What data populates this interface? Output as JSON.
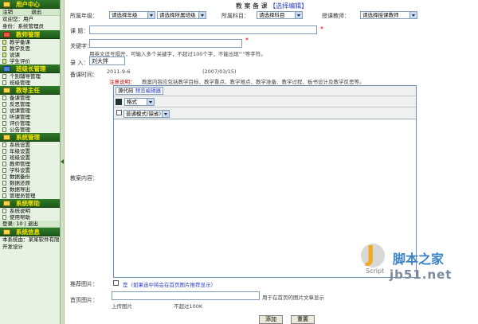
{
  "sidebar": {
    "user_center": "用户中心",
    "user_links": [
      "注销",
      "退出"
    ],
    "user_info": "欢迎您：用户",
    "user_role": "身份：系统管理员",
    "sections": [
      {
        "title": "教师管理",
        "items": [
          "教学备课",
          "教学反思",
          "说课",
          "学生评价"
        ]
      },
      {
        "title": "班级长管理",
        "items": [
          "个别辅导管理",
          "班级管理"
        ]
      },
      {
        "title": "教导主任",
        "items": [
          "备课管理",
          "反思管理",
          "说课管理",
          "听课管理",
          "评价管理",
          "公告管理"
        ]
      },
      {
        "title": "系统管理",
        "items": [
          "系统设置",
          "年级设置",
          "班级设置",
          "教师管理",
          "学科设置",
          "数据备份",
          "数据还原",
          "数据导出",
          "管理员管理"
        ]
      },
      {
        "title": "系统帮助",
        "items": [
          "系统说明",
          "使用帮助"
        ]
      },
      {
        "title": "系统信息",
        "items": []
      }
    ],
    "footer": [
      "登录: 10 | 退出",
      "本系统由：某某软件有限公司",
      "开发设计"
    ]
  },
  "page": {
    "title": "教 案 备 课",
    "title_link": "【选择编辑】",
    "row1": {
      "grade_label": "所属年级：",
      "grade_value": "请选择年级",
      "class_value": "请选择所属班级",
      "subject_label": "所属科目：",
      "subject_value": "请选择科目",
      "teacher_label": "授课教师：",
      "teacher_value": "请选择授课教师"
    },
    "topic_label": "课 题：",
    "summary_label": "关键字：",
    "summary_hint": "用英文逗号隔开，可输入多个关键字，不超过100个字，不能出现\"'\"等字符。",
    "author_label": "录 入：",
    "author_value": "刘大拌",
    "date_label": "备课时间：",
    "date_value": "2011-9-6",
    "date_hint": "(2007/03/15)",
    "notes_red": "注意说明：",
    "notes_text": "教案内容应包括教学目标、教学重点、教学难点、教学准备、教学过程、板书设计及教学反思等。",
    "editor_label": "教案内容：",
    "editor": {
      "source_btn": "源代码",
      "source_btn2": "预览编辑器",
      "format_label": "格式",
      "style_value": "普通模式(缺省)"
    },
    "recommend_label": "推荐图片：",
    "recommend_note": "是（如果选中将会在首页图片推荐显示）",
    "image_label": "首页图片：",
    "image_hint": "用于在首页的图片文章显示",
    "upload_text": "上传图片",
    "upload_note": "不超过100K",
    "submit_btn": "添加",
    "reset_btn": "重置"
  },
  "watermark": {
    "name": "脚本之家",
    "script": "Script",
    "url": "jb51.net"
  },
  "colors": {
    "sidebar_bg": "#e8f2e3",
    "header_green": "#2f7a2a",
    "header_text": "#ffe400",
    "required": "#e00000",
    "link_blue": "#2a3fc8"
  }
}
